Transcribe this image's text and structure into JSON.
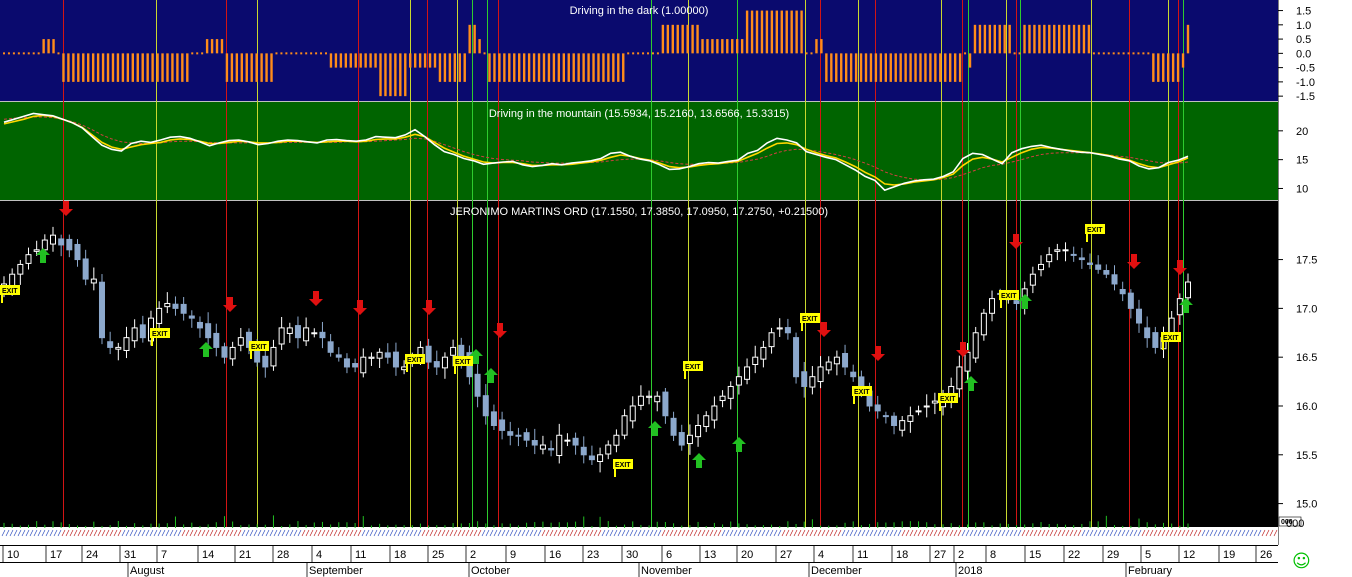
{
  "chart_data": [
    {
      "type": "bar",
      "title": "Driving in the dark (1.00000)",
      "ylim": [
        -1.6,
        1.8
      ],
      "yticks": [
        1.5,
        1.0,
        0.5,
        0.0,
        -0.5,
        -1.0,
        -1.5
      ],
      "ytick_labels": [
        "1.5",
        "1.0",
        "0.5",
        "0.0",
        "-0.5",
        "-1.0",
        "-1.5"
      ],
      "values": [
        0,
        0,
        0,
        0,
        0,
        0,
        0,
        0,
        0.5,
        0.5,
        0.5,
        0,
        -1,
        -1,
        -1,
        -1,
        -1,
        -1,
        -1,
        -1,
        -1,
        -1,
        -1,
        -1,
        -1,
        -1,
        -1,
        -1,
        -1,
        -1,
        -1,
        -1,
        -1,
        -1,
        -1,
        -1,
        -1,
        -1,
        0,
        0,
        0,
        0.5,
        0.5,
        0.5,
        0.5,
        -1,
        -1,
        -1,
        -1,
        -1,
        -1,
        -1,
        -1,
        -1,
        -1,
        0,
        0,
        0,
        0,
        0,
        0,
        0,
        0,
        0,
        0,
        0,
        -0.5,
        -0.5,
        -0.5,
        -0.5,
        -0.5,
        -0.5,
        -0.5,
        -0.5,
        -0.5,
        -0.5,
        -1.5,
        -1.5,
        -1.5,
        -1.5,
        -1.5,
        -1.5,
        -0.5,
        -0.5,
        -0.5,
        -0.5,
        -0.5,
        -0.5,
        -1,
        -1,
        -1,
        -1,
        -1,
        -1,
        1,
        1,
        0.5,
        0,
        -1,
        -1,
        -1,
        -1,
        -1,
        -1,
        -1,
        -1,
        -1,
        -1,
        -1,
        -1,
        -1,
        -1,
        -1,
        -1,
        -1,
        -1,
        -1,
        -1,
        -1,
        -1,
        -1,
        -1,
        -1,
        -1,
        -1,
        -1,
        0,
        0,
        0,
        0,
        0,
        0,
        0,
        1,
        1,
        1,
        1,
        1,
        1,
        1,
        1,
        0.5,
        0.5,
        0.5,
        0.5,
        0.5,
        0.5,
        0.5,
        0.5,
        0.5,
        1.5,
        1.5,
        1.5,
        1.5,
        1.5,
        1.5,
        1.5,
        1.5,
        1.5,
        1.5,
        1.5,
        1.5,
        0,
        0,
        0.5,
        0.5,
        -1,
        -1,
        -1,
        -1,
        -1,
        -1,
        -1,
        -1,
        -1,
        -1,
        -1,
        -1,
        -1,
        -1,
        -1,
        -1,
        -1,
        -1,
        -1,
        -1,
        -1,
        -1,
        -1,
        -1,
        -1,
        -1,
        -1,
        -1,
        0,
        -0.5,
        1,
        1,
        1,
        1,
        1,
        1,
        1,
        1,
        0,
        0,
        1,
        1,
        1,
        1,
        1,
        1,
        1,
        1,
        1,
        1,
        1,
        1,
        1,
        1,
        0,
        0,
        0,
        0,
        0,
        0,
        0,
        0,
        0,
        0,
        0,
        0,
        -1,
        -1,
        -1,
        -1,
        -1,
        -1,
        -0.5,
        1
      ]
    },
    {
      "type": "line",
      "title": "Driving in the mountain (15.5934, 15.2160, 13.6566, 15.3315)",
      "ylim": [
        8,
        25
      ],
      "yticks": [
        20,
        15,
        10
      ],
      "ytick_labels": [
        "20",
        "15",
        "10"
      ],
      "series": [
        {
          "color": "#ffffff",
          "values": [
            21.5,
            22.0,
            22.5,
            23.0,
            22.8,
            22.6,
            22.0,
            21.4,
            20.5,
            19.0,
            17.5,
            16.8,
            16.5,
            17.8,
            18.2,
            18.0,
            18.4,
            18.9,
            19.0,
            18.7,
            18.1,
            17.4,
            17.9,
            18.3,
            18.4,
            18.1,
            17.6,
            17.8,
            18.2,
            18.4,
            18.3,
            18.1,
            17.9,
            18.4,
            18.5,
            18.3,
            18.2,
            18.4,
            19.0,
            18.9,
            18.8,
            19.3,
            20.2,
            19.0,
            17.6,
            16.4,
            15.9,
            15.2,
            14.8,
            14.2,
            14.4,
            14.6,
            14.7,
            14.1,
            13.8,
            14.0,
            14.3,
            14.1,
            14.4,
            14.6,
            14.8,
            15.2,
            16.1,
            16.3,
            15.6,
            15.1,
            14.8,
            14.1,
            13.3,
            13.4,
            13.8,
            14.3,
            14.5,
            14.4,
            14.7,
            14.9,
            16.1,
            16.6,
            17.9,
            18.7,
            18.4,
            17.9,
            16.4,
            15.9,
            15.4,
            15.0,
            14.1,
            13.2,
            12.1,
            11.4,
            9.7,
            10.3,
            10.9,
            11.3,
            11.5,
            11.6,
            12.1,
            12.9,
            15.2,
            16.1,
            15.9,
            15.1,
            14.3,
            16.2,
            16.9,
            17.3,
            17.5,
            17.1,
            16.8,
            16.5,
            16.3,
            16.2,
            15.9,
            15.6,
            15.1,
            14.8,
            13.9,
            13.4,
            13.6,
            14.5,
            14.9,
            15.6
          ]
        },
        {
          "color": "#ffd700",
          "values": [
            21.2,
            21.6,
            22.0,
            22.5,
            22.7,
            22.5,
            22.0,
            21.4,
            20.6,
            19.3,
            18.0,
            17.2,
            16.8,
            17.2,
            17.6,
            17.8,
            18.0,
            18.4,
            18.6,
            18.5,
            18.2,
            17.8,
            17.8,
            18.0,
            18.2,
            18.1,
            17.9,
            17.9,
            18.0,
            18.2,
            18.2,
            18.1,
            18.0,
            18.1,
            18.2,
            18.2,
            18.1,
            18.2,
            18.5,
            18.6,
            18.6,
            18.9,
            19.4,
            19.0,
            18.0,
            17.0,
            16.3,
            15.6,
            15.1,
            14.6,
            14.4,
            14.5,
            14.5,
            14.3,
            14.0,
            14.0,
            14.1,
            14.1,
            14.2,
            14.4,
            14.6,
            14.9,
            15.4,
            15.8,
            15.6,
            15.2,
            14.9,
            14.4,
            13.8,
            13.6,
            13.7,
            14.0,
            14.2,
            14.3,
            14.5,
            14.7,
            15.4,
            16.1,
            17.0,
            17.8,
            17.9,
            17.6,
            16.8,
            16.2,
            15.7,
            15.3,
            14.6,
            13.8,
            12.8,
            12.0,
            10.8,
            10.6,
            10.8,
            11.1,
            11.3,
            11.5,
            11.9,
            12.5,
            14.0,
            15.1,
            15.4,
            15.1,
            14.6,
            15.4,
            16.2,
            16.8,
            17.1,
            17.0,
            16.8,
            16.6,
            16.4,
            16.2,
            16.0,
            15.7,
            15.3,
            14.9,
            14.3,
            13.8,
            13.6,
            14.1,
            14.6,
            15.3
          ]
        },
        {
          "color": "#d04040",
          "dashed": true,
          "values": [
            22.0,
            22.2,
            22.3,
            22.4,
            22.4,
            22.3,
            22.0,
            21.6,
            21.0,
            20.2,
            19.3,
            18.6,
            18.1,
            17.9,
            17.8,
            17.8,
            17.9,
            18.1,
            18.2,
            18.2,
            18.1,
            18.0,
            17.9,
            17.9,
            17.9,
            17.9,
            17.9,
            17.9,
            17.9,
            18.0,
            18.0,
            18.0,
            18.0,
            18.0,
            18.0,
            18.1,
            18.1,
            18.1,
            18.2,
            18.3,
            18.4,
            18.5,
            18.7,
            18.6,
            18.2,
            17.6,
            17.0,
            16.4,
            15.9,
            15.5,
            15.2,
            15.0,
            14.9,
            14.8,
            14.6,
            14.5,
            14.4,
            14.4,
            14.4,
            14.4,
            14.5,
            14.6,
            14.8,
            15.0,
            15.1,
            15.1,
            15.0,
            14.8,
            14.5,
            14.3,
            14.2,
            14.2,
            14.2,
            14.3,
            14.4,
            14.5,
            14.8,
            15.1,
            15.6,
            16.2,
            16.6,
            16.8,
            16.7,
            16.5,
            16.2,
            15.9,
            15.5,
            15.0,
            14.4,
            13.7,
            12.9,
            12.3,
            11.9,
            11.6,
            11.5,
            11.5,
            11.6,
            11.9,
            12.4,
            13.0,
            13.6,
            14.0,
            14.2,
            14.6,
            15.0,
            15.5,
            15.9,
            16.1,
            16.2,
            16.2,
            16.2,
            16.1,
            16.0,
            15.8,
            15.6,
            15.4,
            15.1,
            14.8,
            14.5,
            14.4,
            14.4,
            14.6
          ]
        }
      ]
    },
    {
      "type": "candlestick",
      "title": "JERONIMO MARTINS ORD (17.1550, 17.3850, 17.0950, 17.2750, +0.21500)",
      "ylim": [
        14.75,
        18.1
      ],
      "yticks": [
        17.5,
        17.0,
        16.5,
        16.0,
        15.5,
        15.0
      ],
      "ytick_labels": [
        "17.5",
        "17.0",
        "16.5",
        "16.0",
        "15.5",
        "15.0"
      ],
      "volume_label": "000",
      "close": [
        17.25,
        17.35,
        17.45,
        17.55,
        17.6,
        17.7,
        17.75,
        17.65,
        17.6,
        17.5,
        17.3,
        17.3,
        16.7,
        16.6,
        16.6,
        16.7,
        16.8,
        16.7,
        16.9,
        17.0,
        17.05,
        17.0,
        16.95,
        16.9,
        16.8,
        16.7,
        16.6,
        16.5,
        16.6,
        16.7,
        16.6,
        16.45,
        16.4,
        16.6,
        16.8,
        16.8,
        16.7,
        16.8,
        16.75,
        16.7,
        16.55,
        16.5,
        16.4,
        16.4,
        16.5,
        16.5,
        16.55,
        16.5,
        16.4,
        16.4,
        16.5,
        16.6,
        16.45,
        16.4,
        16.5,
        16.6,
        16.5,
        16.3,
        16.1,
        15.9,
        15.8,
        15.75,
        15.7,
        15.7,
        15.65,
        15.6,
        15.6,
        15.55,
        15.7,
        15.65,
        15.6,
        15.5,
        15.45,
        15.5,
        15.6,
        15.7,
        15.9,
        16.0,
        16.1,
        16.1,
        16.1,
        15.9,
        15.7,
        15.6,
        15.7,
        15.8,
        15.9,
        16.0,
        16.1,
        16.2,
        16.3,
        16.4,
        16.5,
        16.6,
        16.75,
        16.8,
        16.75,
        16.3,
        16.2,
        16.3,
        16.4,
        16.45,
        16.5,
        16.4,
        16.3,
        16.15,
        16.0,
        15.95,
        15.9,
        15.8,
        15.85,
        15.9,
        15.95,
        16.0,
        16.05,
        16.1,
        16.2,
        16.4,
        16.55,
        16.75,
        16.95,
        17.1,
        17.15,
        17.1,
        17.05,
        17.2,
        17.35,
        17.45,
        17.55,
        17.6,
        17.6,
        17.55,
        17.5,
        17.45,
        17.4,
        17.35,
        17.25,
        17.15,
        17.0,
        16.85,
        16.7,
        16.6,
        16.7,
        16.9,
        17.1,
        17.27
      ]
    }
  ],
  "x_day_labels": [
    "10",
    "17",
    "24",
    "31",
    "7",
    "14",
    "21",
    "28",
    "4",
    "11",
    "18",
    "25",
    "2",
    "9",
    "16",
    "23",
    "30",
    "6",
    "13",
    "20",
    "27",
    "4",
    "11",
    "18",
    "27",
    "2",
    "8",
    "15",
    "22",
    "29",
    "5",
    "12",
    "19",
    "26"
  ],
  "x_month_labels": [
    "August",
    "September",
    "October",
    "November",
    "December",
    "2018",
    "February"
  ],
  "exit_label": "EXIT",
  "status_icon": "smiley-icon",
  "colors": {
    "panel_dark_bg": "#0a0a6e",
    "panel_mountain_bg": "#006400",
    "panel_price_bg": "#000000",
    "bars_dark": "#ff8c1a",
    "candle_up": "#ffffff",
    "candle_down": "#8ca8cc",
    "buy_arrow": "#22c022",
    "sell_arrow": "#e01010",
    "exit_flag": "#ffff00",
    "entry_line": "#2ecc2e",
    "exit_line": "#c8d82e",
    "sell_line": "#d21414"
  }
}
